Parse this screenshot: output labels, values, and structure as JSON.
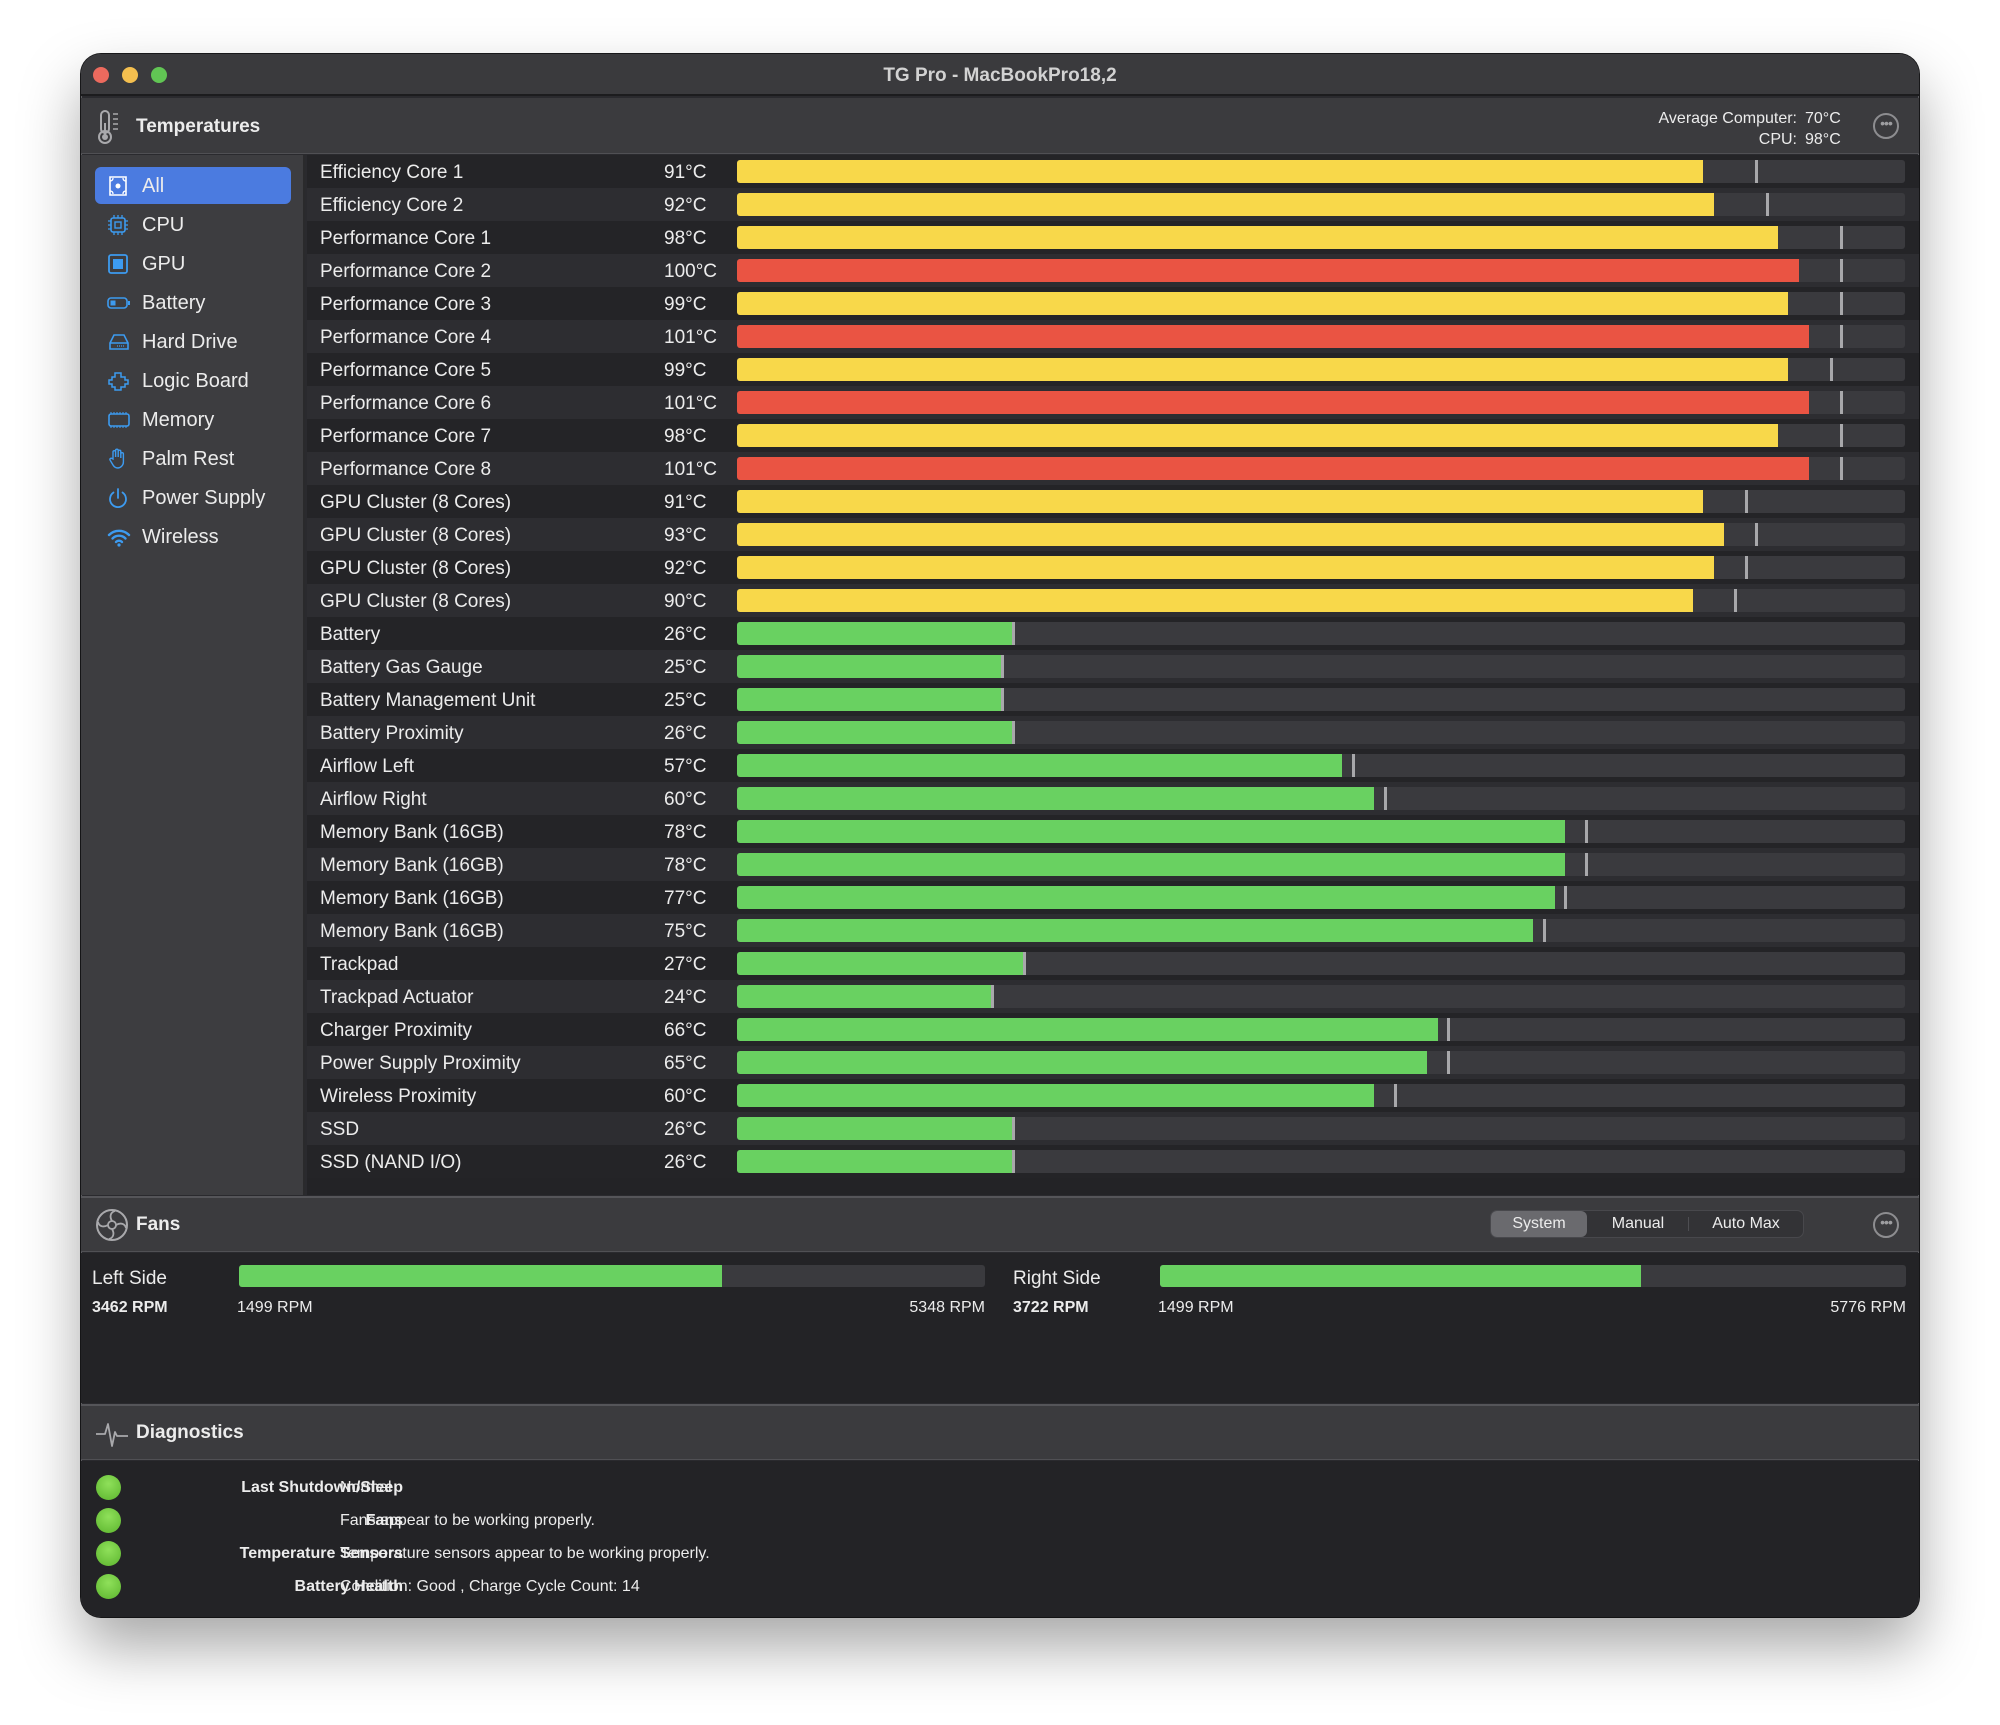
{
  "window": {
    "title": "TG Pro - MacBookPro18,2",
    "traffic_lights": [
      "close",
      "minimize",
      "zoom"
    ]
  },
  "temperatures": {
    "header_title": "Temperatures",
    "summary": [
      {
        "label": "Average Computer:",
        "value": "70°C"
      },
      {
        "label": "CPU:",
        "value": "98°C"
      }
    ],
    "more_icon": "ellipsis-circle-icon"
  },
  "sidebar": {
    "items": [
      {
        "label": "All",
        "icon": "all-icon",
        "active": true
      },
      {
        "label": "CPU",
        "icon": "cpu-icon",
        "active": false
      },
      {
        "label": "GPU",
        "icon": "gpu-icon",
        "active": false
      },
      {
        "label": "Battery",
        "icon": "battery-icon",
        "active": false
      },
      {
        "label": "Hard Drive",
        "icon": "hard-drive-icon",
        "active": false
      },
      {
        "label": "Logic Board",
        "icon": "logic-board-icon",
        "active": false
      },
      {
        "label": "Memory",
        "icon": "memory-icon",
        "active": false
      },
      {
        "label": "Palm Rest",
        "icon": "palm-rest-icon",
        "active": false
      },
      {
        "label": "Power Supply",
        "icon": "power-supply-icon",
        "active": false
      },
      {
        "label": "Wireless",
        "icon": "wireless-icon",
        "active": false
      }
    ],
    "icon_color": "#3d9bf0",
    "active_color": "#4b7be0"
  },
  "scale": {
    "min_c": 0,
    "max_c": 110
  },
  "colors": {
    "hot": "#ea5443",
    "warm": "#f8d84a",
    "normal": "#69d161",
    "marker": "#a8a8ab"
  },
  "sensors": [
    {
      "name": "Efficiency Core 1",
      "temp": "91°C",
      "value": 91,
      "max": 96,
      "level": "warm"
    },
    {
      "name": "Efficiency Core 2",
      "temp": "92°C",
      "value": 92,
      "max": 97,
      "level": "warm"
    },
    {
      "name": "Performance Core 1",
      "temp": "98°C",
      "value": 98,
      "max": 104,
      "level": "warm"
    },
    {
      "name": "Performance Core 2",
      "temp": "100°C",
      "value": 100,
      "max": 104,
      "level": "hot"
    },
    {
      "name": "Performance Core 3",
      "temp": "99°C",
      "value": 99,
      "max": 104,
      "level": "warm"
    },
    {
      "name": "Performance Core 4",
      "temp": "101°C",
      "value": 101,
      "max": 104,
      "level": "hot"
    },
    {
      "name": "Performance Core 5",
      "temp": "99°C",
      "value": 99,
      "max": 103,
      "level": "warm"
    },
    {
      "name": "Performance Core 6",
      "temp": "101°C",
      "value": 101,
      "max": 104,
      "level": "hot"
    },
    {
      "name": "Performance Core 7",
      "temp": "98°C",
      "value": 98,
      "max": 104,
      "level": "warm"
    },
    {
      "name": "Performance Core 8",
      "temp": "101°C",
      "value": 101,
      "max": 104,
      "level": "hot"
    },
    {
      "name": "GPU Cluster (8 Cores)",
      "temp": "91°C",
      "value": 91,
      "max": 95,
      "level": "warm"
    },
    {
      "name": "GPU Cluster (8 Cores)",
      "temp": "93°C",
      "value": 93,
      "max": 96,
      "level": "warm"
    },
    {
      "name": "GPU Cluster (8 Cores)",
      "temp": "92°C",
      "value": 92,
      "max": 95,
      "level": "warm"
    },
    {
      "name": "GPU Cluster (8 Cores)",
      "temp": "90°C",
      "value": 90,
      "max": 94,
      "level": "warm"
    },
    {
      "name": "Battery",
      "temp": "26°C",
      "value": 26,
      "max": 26,
      "level": "normal"
    },
    {
      "name": "Battery Gas Gauge",
      "temp": "25°C",
      "value": 25,
      "max": 25,
      "level": "normal"
    },
    {
      "name": "Battery Management Unit",
      "temp": "25°C",
      "value": 25,
      "max": 25,
      "level": "normal"
    },
    {
      "name": "Battery Proximity",
      "temp": "26°C",
      "value": 26,
      "max": 26,
      "level": "normal"
    },
    {
      "name": "Airflow Left",
      "temp": "57°C",
      "value": 57,
      "max": 58,
      "level": "normal"
    },
    {
      "name": "Airflow Right",
      "temp": "60°C",
      "value": 60,
      "max": 61,
      "level": "normal"
    },
    {
      "name": "Memory Bank (16GB)",
      "temp": "78°C",
      "value": 78,
      "max": 80,
      "level": "normal"
    },
    {
      "name": "Memory Bank (16GB)",
      "temp": "78°C",
      "value": 78,
      "max": 80,
      "level": "normal"
    },
    {
      "name": "Memory Bank (16GB)",
      "temp": "77°C",
      "value": 77,
      "max": 78,
      "level": "normal"
    },
    {
      "name": "Memory Bank (16GB)",
      "temp": "75°C",
      "value": 75,
      "max": 76,
      "level": "normal"
    },
    {
      "name": "Trackpad",
      "temp": "27°C",
      "value": 27,
      "max": 27,
      "level": "normal"
    },
    {
      "name": "Trackpad Actuator",
      "temp": "24°C",
      "value": 24,
      "max": 24,
      "level": "normal"
    },
    {
      "name": "Charger Proximity",
      "temp": "66°C",
      "value": 66,
      "max": 67,
      "level": "normal"
    },
    {
      "name": "Power Supply Proximity",
      "temp": "65°C",
      "value": 65,
      "max": 67,
      "level": "normal"
    },
    {
      "name": "Wireless Proximity",
      "temp": "60°C",
      "value": 60,
      "max": 62,
      "level": "normal"
    },
    {
      "name": "SSD",
      "temp": "26°C",
      "value": 26,
      "max": 26,
      "level": "normal"
    },
    {
      "name": "SSD (NAND I/O)",
      "temp": "26°C",
      "value": 26,
      "max": 26,
      "level": "normal"
    }
  ],
  "fans": {
    "header_title": "Fans",
    "modes": [
      {
        "label": "System",
        "active": true
      },
      {
        "label": "Manual",
        "active": false
      },
      {
        "label": "Auto Max",
        "active": false
      }
    ],
    "items": [
      {
        "name": "Left Side",
        "rpm": "3462 RPM",
        "min": "1499 RPM",
        "max": "5348 RPM",
        "rpm_value": 3462,
        "min_value": 1499,
        "max_value": 5348
      },
      {
        "name": "Right Side",
        "rpm": "3722 RPM",
        "min": "1499 RPM",
        "max": "5776 RPM",
        "rpm_value": 3722,
        "min_value": 1499,
        "max_value": 5776
      }
    ]
  },
  "diagnostics": {
    "header_title": "Diagnostics",
    "items": [
      {
        "label": "Last Shutdown/Sleep",
        "value": "Normal",
        "status": "good"
      },
      {
        "label": "Fans",
        "value": "Fans appear to be working properly.",
        "status": "good"
      },
      {
        "label": "Temperature Sensors",
        "value": "Temperature sensors appear to be working properly.",
        "status": "good"
      },
      {
        "label": "Battery Health",
        "value": "Condition: Good , Charge Cycle Count: 14",
        "status": "good"
      }
    ]
  }
}
